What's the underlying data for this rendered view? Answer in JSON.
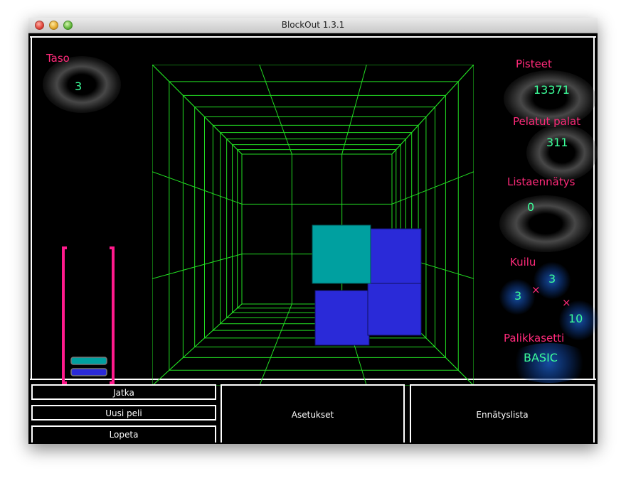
{
  "window": {
    "title": "BlockOut 1.3.1"
  },
  "left": {
    "level_label": "Taso",
    "level_value": "3"
  },
  "right": {
    "score_label": "Pisteet",
    "score_value": "13371",
    "cubes_label": "Pelatut palat",
    "cubes_value": "311",
    "highscore_label": "Listaennätys",
    "highscore_value": "0",
    "pit_label": "Kuilu",
    "pit_width": "3",
    "pit_height": "3",
    "pit_depth": "10",
    "pit_x": "×",
    "blockset_label": "Palikkasetti",
    "blockset_value": "BASIC"
  },
  "menu": {
    "continue": "Jatka",
    "new_game": "Uusi peli",
    "quit": "Lopeta",
    "settings": "Asetukset",
    "highscores": "Ennätyslista"
  },
  "colors": {
    "grid": "#22dd22",
    "label": "#ff2a7a",
    "value": "#3cff9a",
    "cyan_block": "#00a0a0",
    "blue_block": "#2a2ad8",
    "gauge": "#ff1a8c"
  }
}
